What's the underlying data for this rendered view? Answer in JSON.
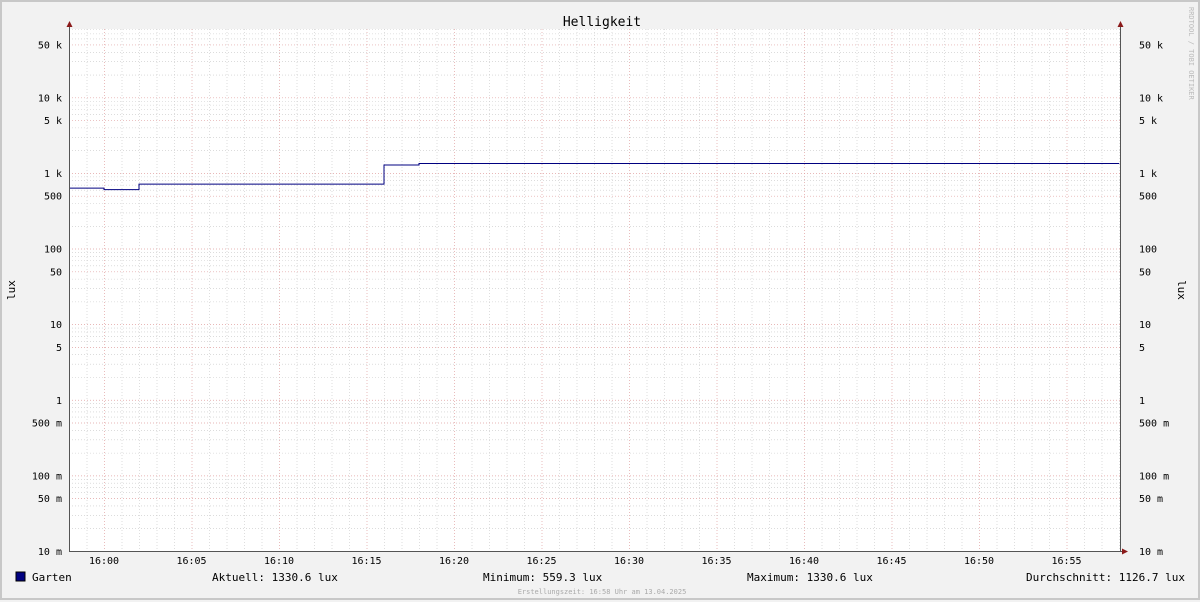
{
  "chart_data": {
    "type": "line",
    "title": "Helligkeit",
    "ylabel": "lux",
    "y_scale": "log",
    "ylim": [
      0.01,
      80000
    ],
    "x_range": [
      "15:58",
      "17:58"
    ],
    "x_ticks": [
      {
        "t": "16:00",
        "label": "16:00"
      },
      {
        "t": "16:05",
        "label": "16:05"
      },
      {
        "t": "16:10",
        "label": "16:10"
      },
      {
        "t": "16:15",
        "label": "16:15"
      },
      {
        "t": "16:20",
        "label": "16:20"
      },
      {
        "t": "16:25",
        "label": "16:25"
      },
      {
        "t": "16:30",
        "label": "16:30"
      },
      {
        "t": "16:35",
        "label": "16:35"
      },
      {
        "t": "16:40",
        "label": "16:40"
      },
      {
        "t": "16:45",
        "label": "16:45"
      },
      {
        "t": "16:50",
        "label": "16:50"
      },
      {
        "t": "16:55",
        "label": "16:55"
      }
    ],
    "y_ticks": [
      {
        "v": 50000,
        "label": "50 k"
      },
      {
        "v": 10000,
        "label": "10 k"
      },
      {
        "v": 5000,
        "label": "5 k"
      },
      {
        "v": 1000,
        "label": "1 k"
      },
      {
        "v": 500,
        "label": "500"
      },
      {
        "v": 100,
        "label": "100"
      },
      {
        "v": 50,
        "label": "50"
      },
      {
        "v": 10,
        "label": "10"
      },
      {
        "v": 5,
        "label": "5"
      },
      {
        "v": 1,
        "label": "1"
      },
      {
        "v": 0.5,
        "label": "500 m"
      },
      {
        "v": 0.1,
        "label": "100 m"
      },
      {
        "v": 0.05,
        "label": "50 m"
      },
      {
        "v": 0.01,
        "label": "10 m"
      }
    ],
    "series": [
      {
        "name": "Garten",
        "color": "#000080",
        "points": [
          [
            "15:58",
            630
          ],
          [
            "16:00",
            600
          ],
          [
            "16:02",
            710
          ],
          [
            "16:16",
            1270
          ],
          [
            "16:18",
            1330
          ],
          [
            "16:58",
            1330.6
          ]
        ]
      }
    ],
    "grid": true,
    "legend": "bottom-left"
  },
  "legend": {
    "series_label": "Garten",
    "series_color": "#000080",
    "current": "Aktuell: 1330.6 lux",
    "minimum": "Minimum: 559.3 lux",
    "maximum": "Maximum: 1330.6 lux",
    "average": "Durchschnitt: 1126.7 lux"
  },
  "footer": "Erstellungszeit: 16:58 Uhr am 13.04.2025",
  "watermark": "RRDTOOL / TOBI OETIKER",
  "colors": {
    "grid_major": "#e0a0a0",
    "grid_minor": "#c8c8c8",
    "axis": "#555555",
    "arrow": "#8b1a1a"
  }
}
